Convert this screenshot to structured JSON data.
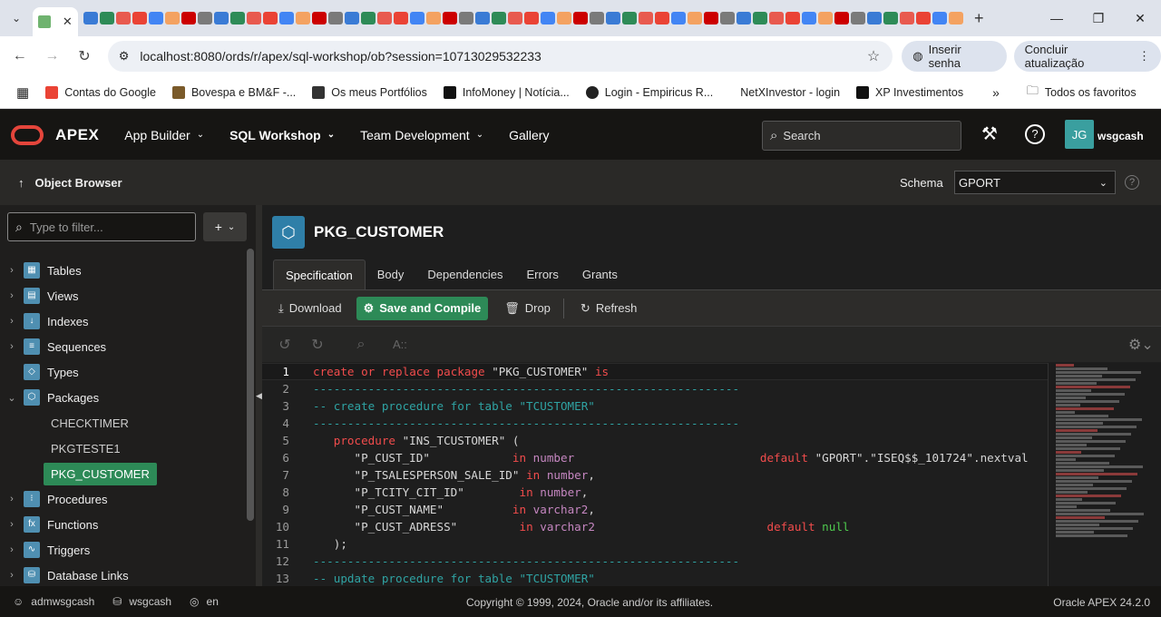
{
  "browser": {
    "url": "localhost:8080/ords/r/apex/sql-workshop/ob?session=10713029532233",
    "password_btn": "Inserir senha",
    "update_btn": "Concluir atualização",
    "bookmarks": [
      "Contas do Google",
      "Bovespa e BM&F -...",
      "Os meus Portfólios",
      "InfoMoney | Notícia...",
      "Login - Empiricus R...",
      "NetXInvestor - login",
      "XP Investimentos"
    ],
    "all_favorites": "Todos os favoritos"
  },
  "header": {
    "app_name": "APEX",
    "menus": [
      "App Builder",
      "SQL Workshop",
      "Team Development",
      "Gallery"
    ],
    "search_placeholder": "Search",
    "avatar_initials": "JG",
    "username": "wsgcash"
  },
  "object_browser": {
    "title": "Object Browser",
    "schema_label": "Schema",
    "schema_value": "GPORT",
    "filter_placeholder": "Type to filter...",
    "add_label": "+"
  },
  "tree": [
    {
      "label": "Tables",
      "icon": "table-icon",
      "expanded": false
    },
    {
      "label": "Views",
      "icon": "view-icon",
      "expanded": false
    },
    {
      "label": "Indexes",
      "icon": "index-icon",
      "expanded": false
    },
    {
      "label": "Sequences",
      "icon": "sequence-icon",
      "expanded": false
    },
    {
      "label": "Types",
      "icon": "type-icon",
      "expanded": false
    },
    {
      "label": "Packages",
      "icon": "package-icon",
      "expanded": true
    },
    {
      "label": "Procedures",
      "icon": "procedure-icon",
      "expanded": false
    },
    {
      "label": "Functions",
      "icon": "function-icon",
      "expanded": false
    },
    {
      "label": "Triggers",
      "icon": "trigger-icon",
      "expanded": false
    },
    {
      "label": "Database Links",
      "icon": "dblink-icon",
      "expanded": false
    }
  ],
  "packages_children": [
    "CHECKTIMER",
    "PKGTESTE1",
    "PKG_CUSTOMER"
  ],
  "selected_package": "PKG_CUSTOMER",
  "main": {
    "object_name": "PKG_CUSTOMER",
    "tabs": [
      "Specification",
      "Body",
      "Dependencies",
      "Errors",
      "Grants"
    ],
    "active_tab": "Specification",
    "toolbar": {
      "download": "Download",
      "save_compile": "Save and Compile",
      "drop": "Drop",
      "refresh": "Refresh"
    },
    "editor_font_btn": "A::"
  },
  "code_lines": [
    "create or replace package \"PKG_CUSTOMER\" is",
    "--------------------------------------------------------------",
    "-- create procedure for table \"TCUSTOMER\"",
    "--------------------------------------------------------------",
    "   procedure \"INS_TCUSTOMER\" (",
    "      \"P_CUST_ID\"            in number                           default \"GPORT\".\"ISEQ$$_101724\".nextval",
    "      \"P_TSALESPERSON_SALE_ID\" in number,",
    "      \"P_TCITY_CIT_ID\"        in number,",
    "      \"P_CUST_NAME\"          in varchar2,",
    "      \"P_CUST_ADRESS\"         in varchar2                         default null",
    "   );",
    "--------------------------------------------------------------",
    "-- update procedure for table \"TCUSTOMER\""
  ],
  "footer": {
    "user": "admwsgcash",
    "workspace": "wsgcash",
    "language": "en",
    "copyright": "Copyright © 1999, 2024, Oracle and/or its affiliates.",
    "version": "Oracle APEX 24.2.0"
  }
}
